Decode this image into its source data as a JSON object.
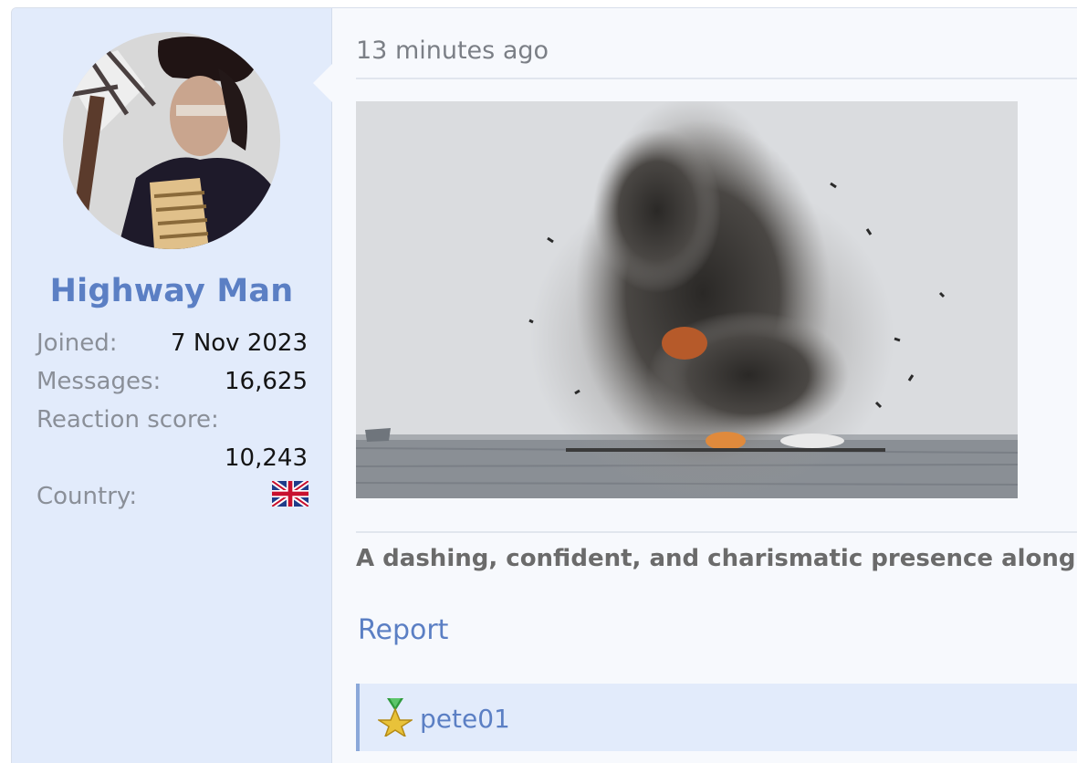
{
  "post": {
    "timestamp": "13 minutes ago",
    "signature": "A dashing, confident, and charismatic presence along wi",
    "report_label": "Report",
    "reaction_user": "pete01"
  },
  "user": {
    "name": "Highway Man",
    "joined_label": "Joined:",
    "joined_value": "7 Nov 2023",
    "messages_label": "Messages:",
    "messages_value": "16,625",
    "reaction_label": "Reaction score:",
    "reaction_value": "10,243",
    "country_label": "Country:",
    "country_flag": "uk-flag-icon"
  },
  "colors": {
    "accent": "#5b7fc4",
    "user_panel_bg": "#e2ebfb",
    "post_bg": "#f7f9fd"
  },
  "icons": [
    "avatar-photo",
    "uk-flag-icon",
    "award-icon"
  ]
}
